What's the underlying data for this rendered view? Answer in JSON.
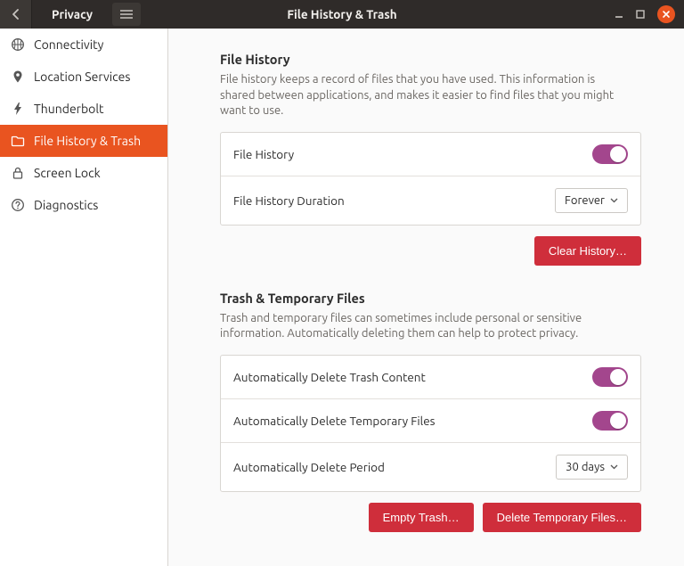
{
  "titlebar": {
    "left_title": "Privacy",
    "center_title": "File History & Trash"
  },
  "sidebar": {
    "items": [
      {
        "label": "Connectivity"
      },
      {
        "label": "Location Services"
      },
      {
        "label": "Thunderbolt"
      },
      {
        "label": "File History & Trash"
      },
      {
        "label": "Screen Lock"
      },
      {
        "label": "Diagnostics"
      }
    ]
  },
  "file_history": {
    "title": "File History",
    "desc": "File history keeps a record of files that you have used. This information is shared between applications, and makes it easier to find files that you might want to use.",
    "toggle_label": "File History",
    "duration_label": "File History Duration",
    "duration_value": "Forever",
    "clear_btn": "Clear History…"
  },
  "trash": {
    "title": "Trash & Temporary Files",
    "desc": "Trash and temporary files can sometimes include personal or sensitive information. Automatically deleting them can help to protect privacy.",
    "del_trash_label": "Automatically Delete Trash Content",
    "del_temp_label": "Automatically Delete Temporary Files",
    "period_label": "Automatically Delete Period",
    "period_value": "30 days",
    "empty_btn": "Empty Trash…",
    "del_temp_btn": "Delete Temporary Files…"
  }
}
